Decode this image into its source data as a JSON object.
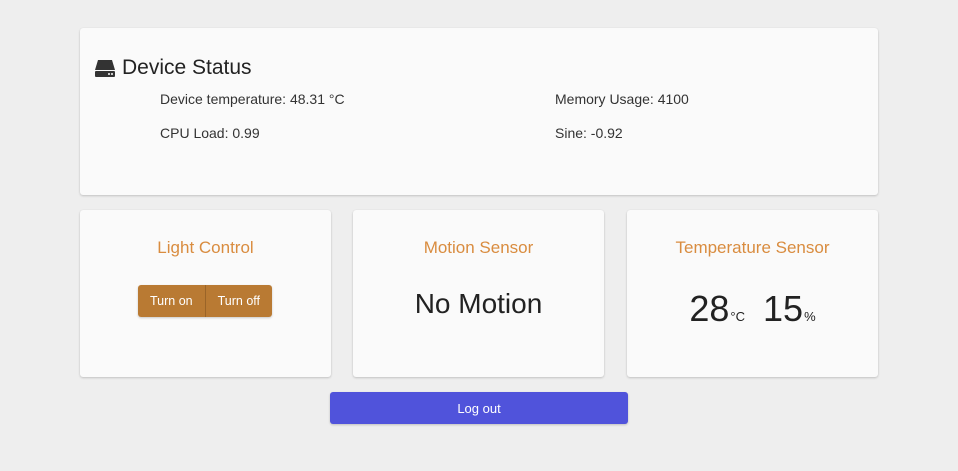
{
  "device_status": {
    "title": "Device Status",
    "icon": "hard-drive-icon",
    "temperature_label": "Device temperature: 48.31 °C",
    "cpu_label": "CPU Load: 0.99",
    "memory_label": "Memory Usage: 4100",
    "sine_label": "Sine: -0.92"
  },
  "light_control": {
    "title": "Light Control",
    "on_label": "Turn on",
    "off_label": "Turn off"
  },
  "motion_sensor": {
    "title": "Motion Sensor",
    "value": "No Motion"
  },
  "temperature_sensor": {
    "title": "Temperature Sensor",
    "temperature": "28",
    "temperature_unit": "°C",
    "humidity": "15",
    "humidity_unit": "%"
  },
  "logout_label": "Log out",
  "colors": {
    "accent": "#d98c3f",
    "button": "#b97a33",
    "logout": "#5053db"
  }
}
